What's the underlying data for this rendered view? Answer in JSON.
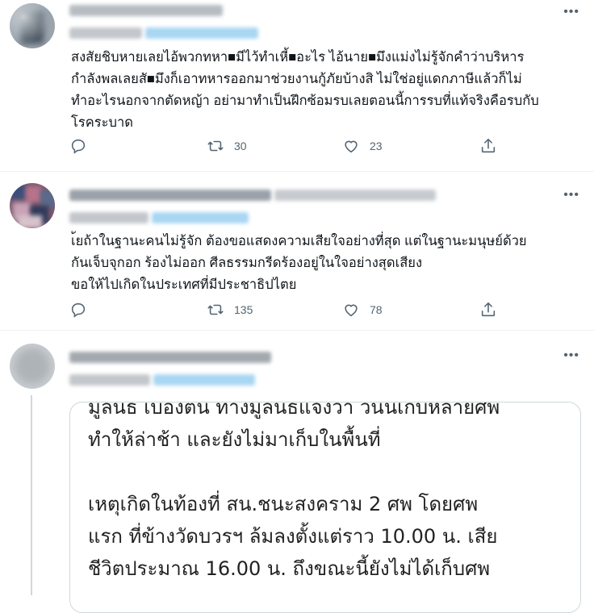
{
  "tweets": [
    {
      "text": "สงสัยชิบหายเลยไอ้พวกทหา■มีไว้ทำเหี้■อะไร ไอ้นาย■มึงแม่งไม่รู้จักคำว่าบริหาร\nกำลังพลเลยสั■มึงก็เอาทหารออกมาช่วยงานกู้ภัยบ้างสิ ไม่ใช่อยู่แดกภาษีแล้วก็ไม่\nทำอะไรนอกจากตัดหญ้า อย่ามาทำเป็นฝึกซ้อมรบเลยตอนนี้การรบที่แท้จริงคือรบกับ\nโรคระบาด",
      "retweets": "30",
      "likes": "23"
    },
    {
      "text": "เ้ยถ้าในฐานะคนไม่รู้จัก ต้องขอแสดงความเสียใจอย่างที่สุด แต่ในฐานะมนุษย์ด้วย\nกันเจ็บจุกอก ร้องไม่ออก ศีลธรรมกรีดร้องอยู่ในใจอย่างสุดเสียง\nขอให้ไปเกิดในประเทศที่มีประชาธิปไตย",
      "retweets": "135",
      "likes": "78"
    },
    {
      "media_text": "มูลนธ เบองตน ทางมูลนธแจงวา วนนเกบหลายศพ\nทำให้ล่าช้า และยังไม่มาเก็บในพื้นที่\n\nเหตุเกิดในท้องที่ สน.ชนะสงคราม 2 ศพ โดยศพ\nแรก ที่ข้างวัดบวรฯ ล้มลงตั้งแต่ราว 10.00 น. เสีย\nชีวิตประมาณ 16.00 น. ถึงขณะนี้ยังไม่ได้เก็บศพ"
    }
  ],
  "icons": {
    "more": "more-icon",
    "reply": "reply-icon",
    "retweet": "retweet-icon",
    "like": "like-icon",
    "share": "share-icon"
  },
  "colors": {
    "icon_gray": "#536471",
    "divider": "#eff3f4",
    "blur_link": "#a9d6f2"
  },
  "more_glyph": "•••"
}
